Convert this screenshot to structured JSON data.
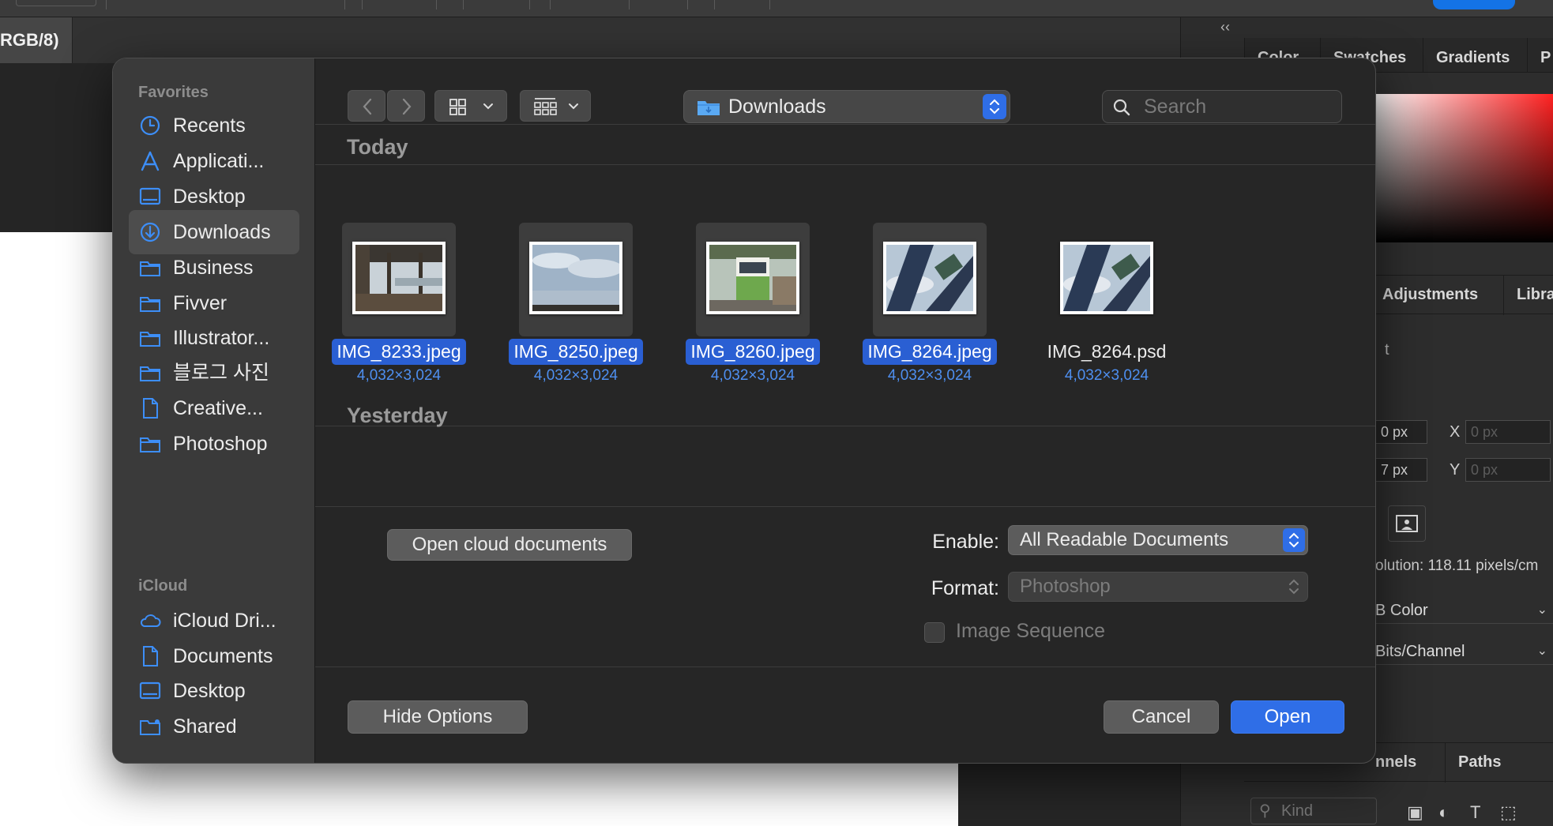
{
  "photoshop": {
    "doc_tab": "RGB/8)",
    "panel_tabs_top": [
      "Color",
      "Swatches",
      "Gradients",
      "P"
    ],
    "panel_tabs_mid": [
      "Adjustments",
      "Librari"
    ],
    "fields": {
      "x_label": "X",
      "y_label": "Y",
      "x_value": "0 px",
      "y_value": "0 px",
      "w_value": "0 px",
      "h_value": "7 px"
    },
    "resolution": "olution: 118.11 pixels/cm",
    "color_mode": "B Color",
    "bit_depth": "Bits/Channel",
    "panel_tabs_bottom": [
      "nnels",
      "Paths"
    ],
    "kind_placeholder": "Kind",
    "collapse": "‹‹",
    "partial_label": "t"
  },
  "dialog": {
    "sidebar": {
      "favorites_heading": "Favorites",
      "favorites": [
        {
          "label": "Recents",
          "icon": "clock-icon"
        },
        {
          "label": "Applicati...",
          "icon": "applications-icon"
        },
        {
          "label": "Desktop",
          "icon": "desktop-icon"
        },
        {
          "label": "Downloads",
          "icon": "downloads-icon",
          "selected": true
        },
        {
          "label": "Business",
          "icon": "folder-icon"
        },
        {
          "label": "Fivver",
          "icon": "folder-icon"
        },
        {
          "label": "Illustrator...",
          "icon": "folder-icon"
        },
        {
          "label": "블로그 사진",
          "icon": "folder-icon"
        },
        {
          "label": "Creative...",
          "icon": "document-icon"
        },
        {
          "label": "Photoshop",
          "icon": "folder-icon"
        }
      ],
      "icloud_heading": "iCloud",
      "icloud": [
        {
          "label": "iCloud Dri...",
          "icon": "cloud-icon"
        },
        {
          "label": "Documents",
          "icon": "document-icon"
        },
        {
          "label": "Desktop",
          "icon": "desktop-icon"
        },
        {
          "label": "Shared",
          "icon": "shared-folder-icon"
        }
      ]
    },
    "toolbar": {
      "location": "Downloads",
      "search_placeholder": "Search"
    },
    "sections": {
      "today": "Today",
      "yesterday": "Yesterday"
    },
    "files": [
      {
        "name": "IMG_8233.jpeg",
        "dims": "4,032×3,024",
        "selected": true
      },
      {
        "name": "IMG_8250.jpeg",
        "dims": "4,032×3,024",
        "selected": true
      },
      {
        "name": "IMG_8260.jpeg",
        "dims": "4,032×3,024",
        "selected": true
      },
      {
        "name": "IMG_8264.jpeg",
        "dims": "4,032×3,024",
        "selected": true
      },
      {
        "name": "IMG_8264.psd",
        "dims": "4,032×3,024",
        "selected": false
      }
    ],
    "options": {
      "cloud_button": "Open cloud documents",
      "enable_label": "Enable:",
      "enable_value": "All Readable Documents",
      "format_label": "Format:",
      "format_value": "Photoshop",
      "image_sequence": "Image Sequence"
    },
    "buttons": {
      "hide_options": "Hide Options",
      "cancel": "Cancel",
      "open": "Open"
    },
    "colors": {
      "accent": "#2f6ee7",
      "selection": "#2a5fd3",
      "dims_text": "#4e8ff0"
    }
  }
}
